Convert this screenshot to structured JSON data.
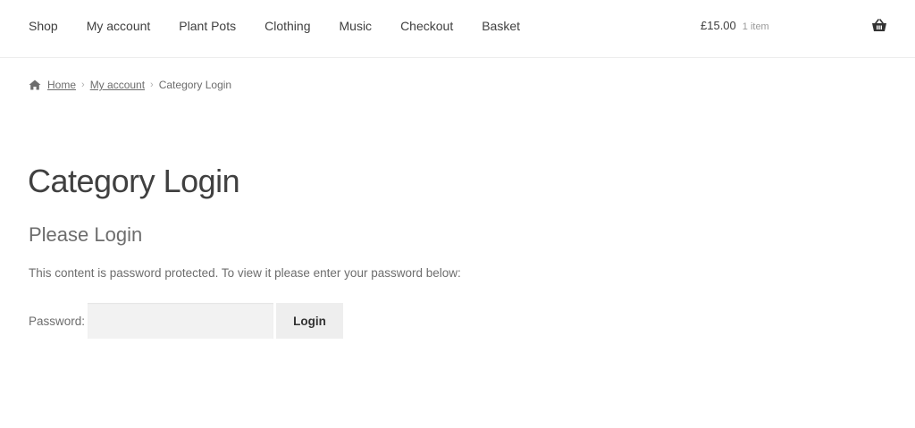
{
  "nav": {
    "items": [
      {
        "label": "Shop"
      },
      {
        "label": "My account"
      },
      {
        "label": "Plant Pots"
      },
      {
        "label": "Clothing"
      },
      {
        "label": "Music"
      },
      {
        "label": "Checkout"
      },
      {
        "label": "Basket"
      }
    ]
  },
  "cart": {
    "amount": "£15.00",
    "count": "1 item",
    "icon": "basket-icon"
  },
  "breadcrumb": {
    "icon": "home-icon",
    "home": "Home",
    "account": "My account",
    "current": "Category Login"
  },
  "page": {
    "title": "Category Login",
    "subheading": "Please Login",
    "description": "This content is password protected. To view it please enter your password below:"
  },
  "form": {
    "password_label": "Password:",
    "password_value": "",
    "login_label": "Login"
  }
}
